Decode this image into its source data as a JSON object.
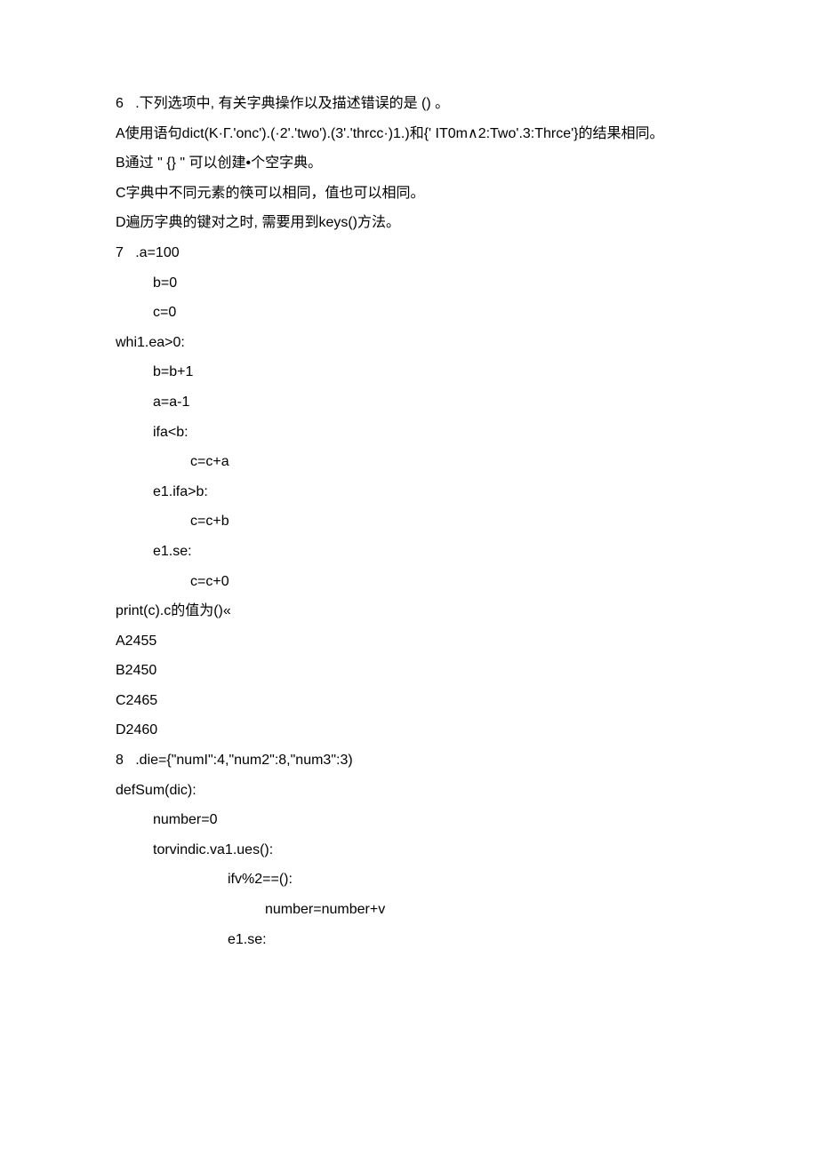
{
  "q6": {
    "stem": "6   .下列选项中, 有关字典操作以及描述错误的是 () 。",
    "optA": "A使用语句dict(K·Γ.'onc').(·2'.'two').(3'.'thrcc·)1.)和{' IT0m∧2:Two'.3:Thrce'}的结果相同。",
    "optB": "B通过 \" {} \" 可以创建•个空字典。",
    "optC": "C字典中不同元素的筷可以相同，值也可以相同。",
    "optD": "D遍历字典的键对之时, 需要用到keys()方法。"
  },
  "q7": {
    "line1": "7   .a=100",
    "line2": "b=0",
    "line3": "c=0",
    "line4": "whi1.ea>0:",
    "line5": "b=b+1",
    "line6": "a=a-1",
    "line7": "ifa<b:",
    "line8": "c=c+a",
    "line9": "e1.ifa>b:",
    "line10": "c=c+b",
    "line11": "e1.se:",
    "line12": "c=c+0",
    "line13": "print(c).c的值为()«",
    "optA": "A2455",
    "optB": "B2450",
    "optC": "C2465",
    "optD": "D2460"
  },
  "q8": {
    "line1": "8   .die={\"numI\":4,\"num2\":8,\"num3\":3)",
    "line2": "defSum(dic):",
    "line3": "number=0",
    "line4": "torvindic.va1.ues():",
    "line5": "ifv%2==():",
    "line6": "number=number+v",
    "line7": "e1.se:"
  }
}
